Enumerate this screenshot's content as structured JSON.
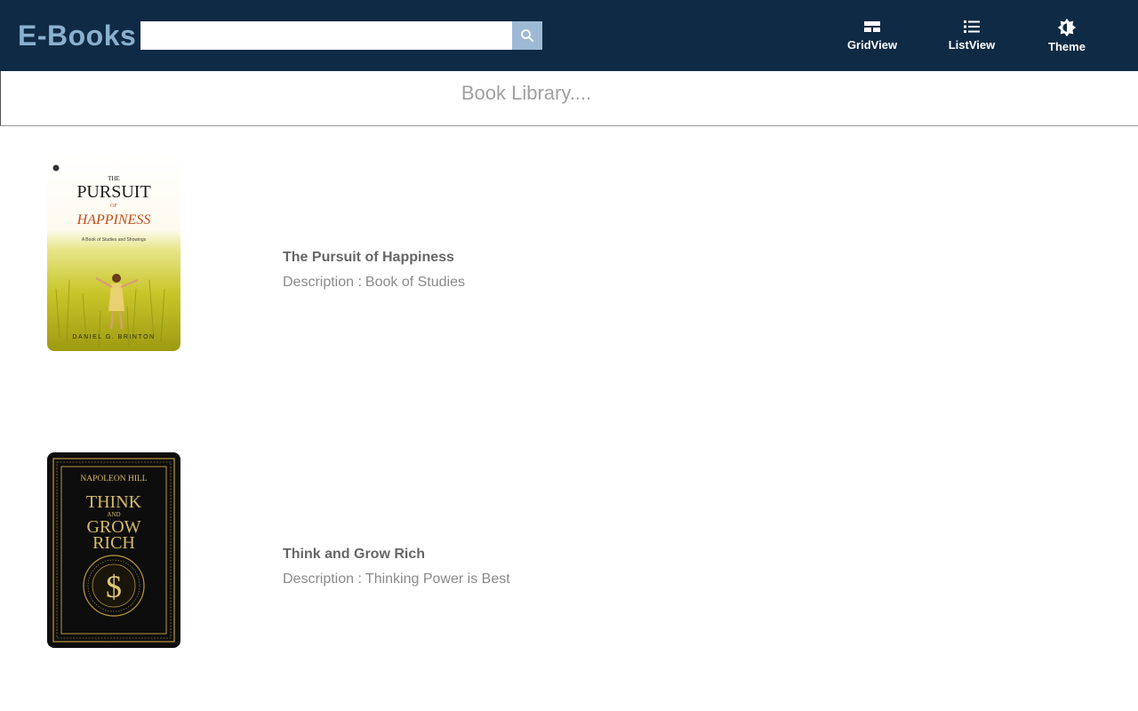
{
  "header": {
    "brand": "E-Books",
    "search": {
      "value": "",
      "placeholder": "",
      "icon": "search-icon"
    },
    "nav": [
      {
        "label": "GridView",
        "icon": "grid-view-icon"
      },
      {
        "label": "ListView",
        "icon": "list-view-icon"
      },
      {
        "label": "Theme",
        "icon": "brightness-icon"
      }
    ]
  },
  "subheader": {
    "title": "Book Library...."
  },
  "books": [
    {
      "title": "The Pursuit of Happiness",
      "desc_label": "Description :",
      "description": "Book of Studies",
      "cover": {
        "line1": "THE",
        "line2": "PURSUIT",
        "line3": "OF",
        "line4": "HAPPINESS",
        "subtitle": "A Book of Studies and Showings",
        "author": "DANIEL G. BRINTON"
      }
    },
    {
      "title": "Think and Grow Rich",
      "desc_label": "Description :",
      "description": "Thinking Power is Best",
      "cover": {
        "author": "NAPOLEON HILL",
        "line1": "THINK",
        "line2": "AND",
        "line3": "GROW",
        "line4": "RICH",
        "symbol": "$"
      }
    }
  ],
  "colors": {
    "topbar": "#0f2a44",
    "brand": "#8ab0d0",
    "search_button": "#9eb9d6",
    "subheader_text": "#a0a0a0"
  }
}
